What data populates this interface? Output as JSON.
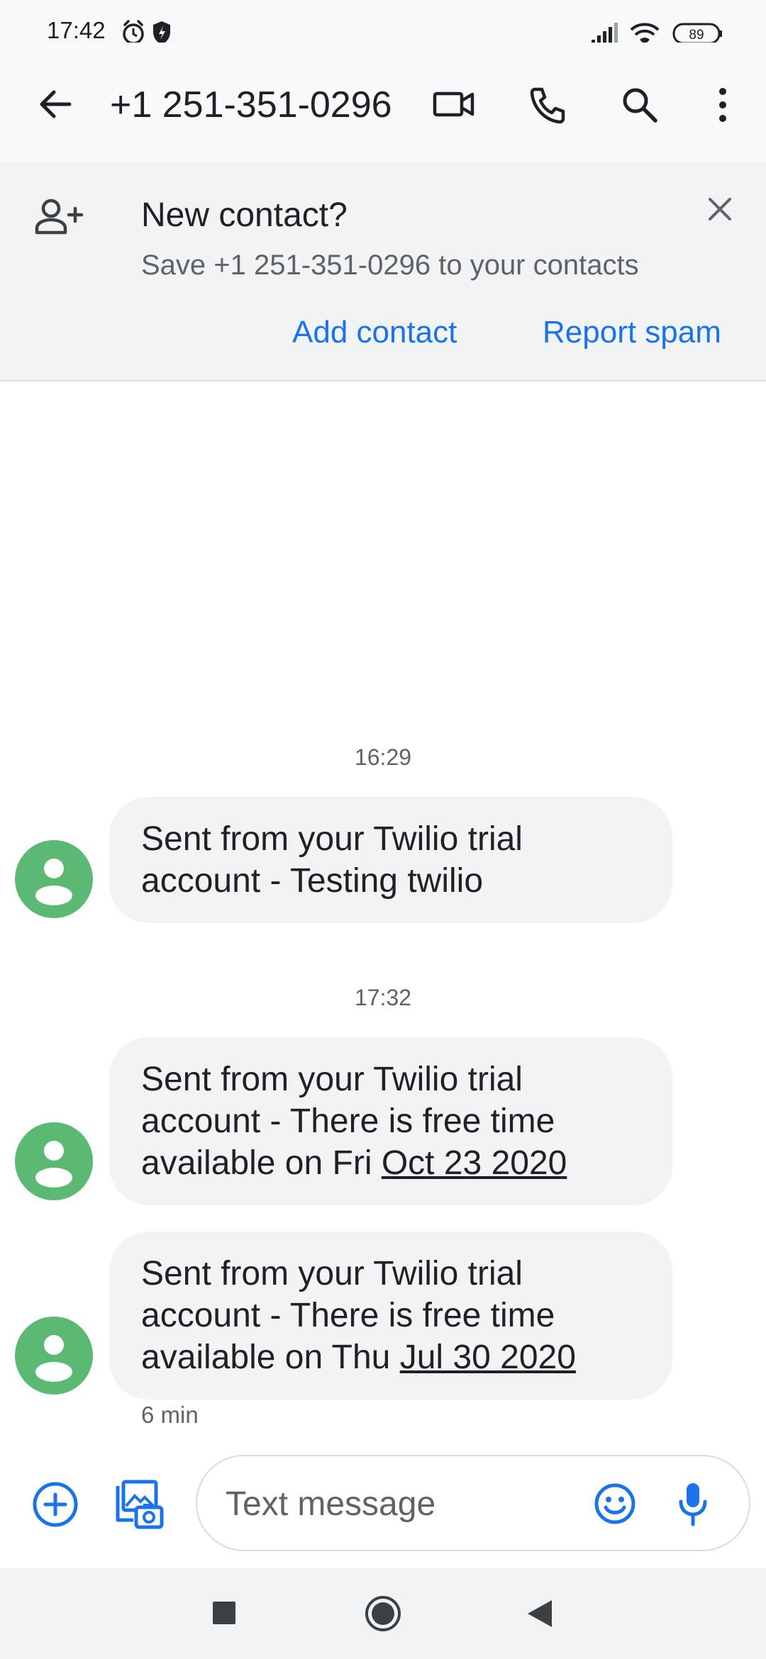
{
  "status_bar": {
    "time": "17:42",
    "battery": "89",
    "icons_left": [
      "alarm-icon",
      "shield-icon"
    ],
    "icons_right": [
      "signal-icon",
      "wifi-icon",
      "battery-icon"
    ]
  },
  "app_bar": {
    "title": "+1 251-351-0296",
    "icons": [
      "back-arrow-icon",
      "video-call-icon",
      "phone-icon",
      "search-icon",
      "more-vert-icon"
    ]
  },
  "banner": {
    "title": "New contact?",
    "subtitle": "Save +1 251-351-0296 to your contacts",
    "add_contact_label": "Add contact",
    "report_spam_label": "Report spam",
    "icons": [
      "add-person-icon",
      "close-icon"
    ]
  },
  "conversation": {
    "groups": [
      {
        "timestamp": "16:29",
        "messages": [
          {
            "text": "Sent from your Twilio trial account - Testing twilio"
          }
        ]
      },
      {
        "timestamp": "17:32",
        "messages": [
          {
            "text_prefix": "Sent from your Twilio trial account - There is free time available on Fri ",
            "link": "Oct 23 2020"
          },
          {
            "text_prefix": "Sent from your Twilio trial account - There is free time available on Thu ",
            "link": "Jul 30 2020"
          }
        ]
      }
    ],
    "last_message_time": "6 min"
  },
  "compose": {
    "placeholder": "Text message",
    "icons": [
      "add-circle-icon",
      "gallery-camera-icon",
      "emoji-icon",
      "mic-icon"
    ]
  },
  "nav_bar": {
    "icons": [
      "recents-square-icon",
      "home-circle-icon",
      "back-triangle-icon"
    ]
  },
  "colors": {
    "accent": "#1a73e8",
    "avatar": "#5bb974",
    "bubble": "#f1f3f4",
    "bar": "#f8f9fa"
  }
}
